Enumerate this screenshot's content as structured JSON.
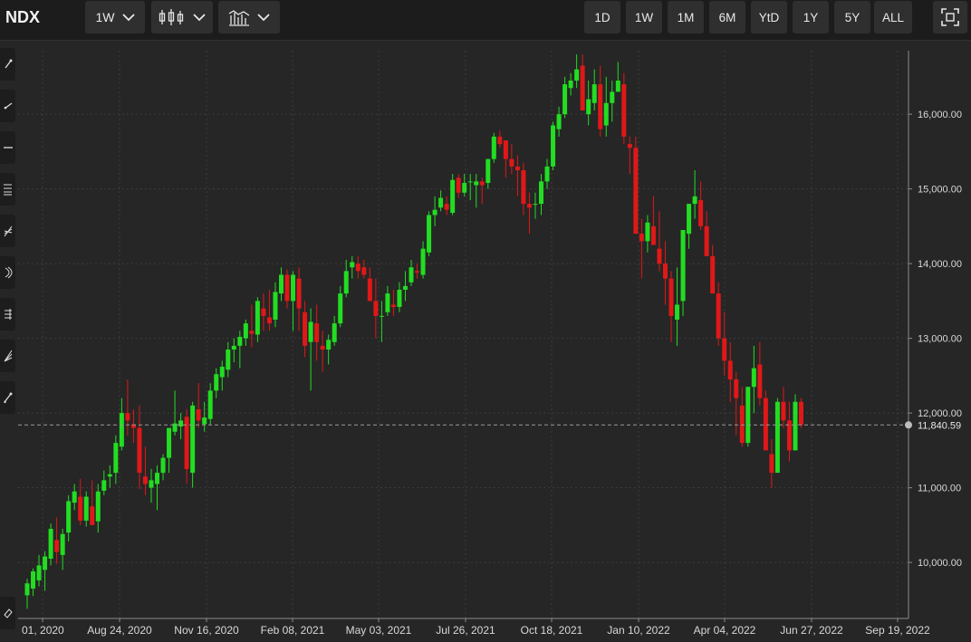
{
  "toolbar": {
    "symbol": "NDX",
    "interval_label": "1W",
    "chart_style_icon": "candlestick-icon",
    "indicators_icon": "indicators-icon",
    "ranges": [
      "1D",
      "1W",
      "1M",
      "6M",
      "YtD",
      "1Y",
      "5Y",
      "ALL"
    ],
    "fullscreen_icon": "fullscreen-icon"
  },
  "sidebar": {
    "tools": [
      "trendline-icon",
      "ray-icon",
      "horizontal-line-icon",
      "fibonacci-icon",
      "pitchfork-icon",
      "arc-icon",
      "parallel-channel-icon",
      "gann-fan-icon",
      "measure-icon",
      "eraser-icon"
    ]
  },
  "colors": {
    "up": "#22dd22",
    "down": "#e01818",
    "background": "#262626",
    "grid": "#3c3c3c"
  },
  "chart_data": {
    "type": "candlestick",
    "title": "",
    "xlabel": "",
    "ylabel": "",
    "ylim": [
      9250,
      16850
    ],
    "y_ticks": [
      10000,
      11000,
      12000,
      13000,
      14000,
      15000,
      16000
    ],
    "y_tick_labels": [
      "10,000.00",
      "11,000.00",
      "12,000.00",
      "13,000.00",
      "14,000.00",
      "15,000.00",
      "16,000.00"
    ],
    "x_tick_labels": [
      "01, 2020",
      "Aug 24, 2020",
      "Nov 16, 2020",
      "Feb 08, 2021",
      "May 03, 2021",
      "Jul 26, 2021",
      "Oct 18, 2021",
      "Jan 10, 2022",
      "Apr 04, 2022",
      "Jun 27, 2022",
      "Sep 19, 2022"
    ],
    "last_value": 11840.59,
    "last_value_label": "11,840.59",
    "grid": true,
    "series": [
      {
        "ohlc": [
          [
            9560,
            9780,
            9380,
            9720
          ],
          [
            9650,
            9920,
            9550,
            9880
          ],
          [
            9760,
            10100,
            9680,
            9960
          ],
          [
            9900,
            10150,
            9620,
            10080
          ],
          [
            10050,
            10520,
            9960,
            10450
          ],
          [
            10300,
            10600,
            9980,
            10140
          ],
          [
            10100,
            10450,
            9900,
            10380
          ],
          [
            10400,
            10900,
            10280,
            10820
          ],
          [
            10800,
            11050,
            10700,
            10950
          ],
          [
            10880,
            11120,
            10500,
            10560
          ],
          [
            10560,
            10950,
            10480,
            10880
          ],
          [
            10750,
            11100,
            10500,
            10500
          ],
          [
            10550,
            11050,
            10400,
            10950
          ],
          [
            10960,
            11230,
            10900,
            11100
          ],
          [
            11150,
            11300,
            11000,
            11180
          ],
          [
            11200,
            11700,
            11050,
            11600
          ],
          [
            11550,
            12200,
            11500,
            12000
          ],
          [
            12000,
            12450,
            11700,
            11900
          ],
          [
            11850,
            12050,
            11600,
            11800
          ],
          [
            11800,
            12100,
            10980,
            11200
          ],
          [
            11150,
            11550,
            10900,
            11050
          ],
          [
            11000,
            11250,
            10800,
            11100
          ],
          [
            11050,
            11300,
            10700,
            11200
          ],
          [
            11200,
            11450,
            11100,
            11400
          ],
          [
            11400,
            11800,
            11200,
            11800
          ],
          [
            11750,
            12300,
            11700,
            11860
          ],
          [
            11820,
            12000,
            11650,
            11900
          ],
          [
            11950,
            12050,
            11050,
            11250
          ],
          [
            11200,
            12150,
            11000,
            12100
          ],
          [
            12050,
            12400,
            11800,
            11900
          ],
          [
            11850,
            12150,
            11750,
            11940
          ],
          [
            11920,
            12400,
            11850,
            12300
          ],
          [
            12300,
            12600,
            12200,
            12520
          ],
          [
            12480,
            12700,
            12300,
            12620
          ],
          [
            12580,
            12950,
            12480,
            12850
          ],
          [
            12850,
            13000,
            12680,
            12900
          ],
          [
            12900,
            13100,
            12600,
            13020
          ],
          [
            13000,
            13250,
            12900,
            13200
          ],
          [
            13100,
            13450,
            12880,
            13060
          ],
          [
            13050,
            13550,
            12950,
            13500
          ],
          [
            13400,
            13600,
            13100,
            13300
          ],
          [
            13280,
            13650,
            13100,
            13200
          ],
          [
            13250,
            13750,
            13150,
            13620
          ],
          [
            13600,
            13950,
            13500,
            13850
          ],
          [
            13850,
            13920,
            13400,
            13500
          ],
          [
            13500,
            13900,
            13100,
            13850
          ],
          [
            13800,
            13950,
            13100,
            13400
          ],
          [
            13350,
            13500,
            12750,
            12900
          ],
          [
            12950,
            13400,
            12300,
            13220
          ],
          [
            13200,
            13450,
            12700,
            12950
          ],
          [
            12900,
            13100,
            12550,
            12850
          ],
          [
            12850,
            13050,
            12650,
            12980
          ],
          [
            12950,
            13300,
            12900,
            13200
          ],
          [
            13200,
            13700,
            13150,
            13600
          ],
          [
            13600,
            14050,
            13550,
            13900
          ],
          [
            13950,
            14100,
            13800,
            14020
          ],
          [
            14000,
            14100,
            13800,
            13900
          ],
          [
            13950,
            14050,
            13800,
            13850
          ],
          [
            13800,
            13950,
            13500,
            13500
          ],
          [
            13500,
            13800,
            13000,
            13300
          ],
          [
            13300,
            13500,
            12950,
            13300
          ],
          [
            13350,
            13700,
            13300,
            13600
          ],
          [
            13450,
            13650,
            13300,
            13420
          ],
          [
            13420,
            13750,
            13350,
            13650
          ],
          [
            13650,
            13900,
            13500,
            13700
          ],
          [
            13750,
            14050,
            13700,
            13950
          ],
          [
            13900,
            14000,
            13800,
            13880
          ],
          [
            13850,
            14300,
            13800,
            14200
          ],
          [
            14150,
            14700,
            14100,
            14650
          ],
          [
            14650,
            14900,
            14500,
            14720
          ],
          [
            14750,
            14980,
            14700,
            14880
          ],
          [
            14800,
            14900,
            14650,
            14720
          ],
          [
            14680,
            15200,
            14650,
            15120
          ],
          [
            15150,
            15200,
            14880,
            14950
          ],
          [
            14950,
            15200,
            14900,
            15080
          ],
          [
            15100,
            15200,
            14850,
            15100
          ],
          [
            15050,
            15200,
            14750,
            15100
          ],
          [
            15100,
            15150,
            14800,
            15050
          ],
          [
            15080,
            15400,
            15000,
            15400
          ],
          [
            15400,
            15750,
            15350,
            15700
          ],
          [
            15700,
            15780,
            15550,
            15600
          ],
          [
            15650,
            15650,
            15150,
            15400
          ],
          [
            15400,
            15600,
            15200,
            15300
          ],
          [
            15300,
            15450,
            14900,
            15250
          ],
          [
            15250,
            15350,
            14650,
            14800
          ],
          [
            14800,
            14950,
            14400,
            14750
          ],
          [
            14800,
            14950,
            14600,
            14800
          ],
          [
            14800,
            15200,
            14650,
            15100
          ],
          [
            15100,
            15400,
            15000,
            15300
          ],
          [
            15300,
            15900,
            15250,
            15850
          ],
          [
            15800,
            16100,
            15700,
            16000
          ],
          [
            16000,
            16500,
            15950,
            16400
          ],
          [
            16350,
            16550,
            16250,
            16450
          ],
          [
            16450,
            16800,
            16350,
            16600
          ],
          [
            16650,
            16800,
            16050,
            16050
          ],
          [
            16000,
            16450,
            15850,
            16200
          ],
          [
            16150,
            16600,
            16050,
            16400
          ],
          [
            16400,
            16650,
            15700,
            15800
          ],
          [
            15850,
            16500,
            15700,
            16150
          ],
          [
            16150,
            16450,
            15900,
            16300
          ],
          [
            16300,
            16700,
            16300,
            16450
          ],
          [
            16400,
            16550,
            15600,
            15700
          ],
          [
            15600,
            15700,
            15200,
            15550
          ],
          [
            15550,
            15700,
            14450,
            14400
          ],
          [
            14400,
            14600,
            13800,
            14300
          ],
          [
            14300,
            14650,
            14150,
            14550
          ],
          [
            14500,
            14900,
            14250,
            14250
          ],
          [
            14200,
            14700,
            13900,
            14000
          ],
          [
            14000,
            14300,
            13450,
            13800
          ],
          [
            13800,
            13900,
            12950,
            13300
          ],
          [
            13250,
            13950,
            12900,
            13450
          ],
          [
            13500,
            14350,
            13300,
            14450
          ],
          [
            14400,
            14800,
            14200,
            14800
          ],
          [
            14800,
            15250,
            14600,
            14900
          ],
          [
            14850,
            15100,
            14450,
            14500
          ],
          [
            14500,
            14700,
            14100,
            14100
          ],
          [
            14100,
            14250,
            13600,
            13600
          ],
          [
            13600,
            13750,
            12900,
            13000
          ],
          [
            13000,
            13350,
            12500,
            12700
          ],
          [
            12700,
            12950,
            12150,
            12450
          ],
          [
            12450,
            12550,
            11700,
            12200
          ],
          [
            12100,
            12350,
            11550,
            11600
          ],
          [
            11600,
            12350,
            11550,
            12350
          ],
          [
            12350,
            12900,
            12000,
            12600
          ],
          [
            12650,
            12950,
            12100,
            12200
          ],
          [
            12200,
            12300,
            11500,
            11500
          ],
          [
            11450,
            11650,
            11000,
            11200
          ],
          [
            11200,
            12200,
            11300,
            12150
          ],
          [
            12150,
            12350,
            11800,
            11900
          ],
          [
            11900,
            12150,
            11350,
            11500
          ],
          [
            11500,
            12250,
            11500,
            12150
          ],
          [
            12150,
            12200,
            11800,
            11840.59
          ]
        ]
      }
    ]
  }
}
